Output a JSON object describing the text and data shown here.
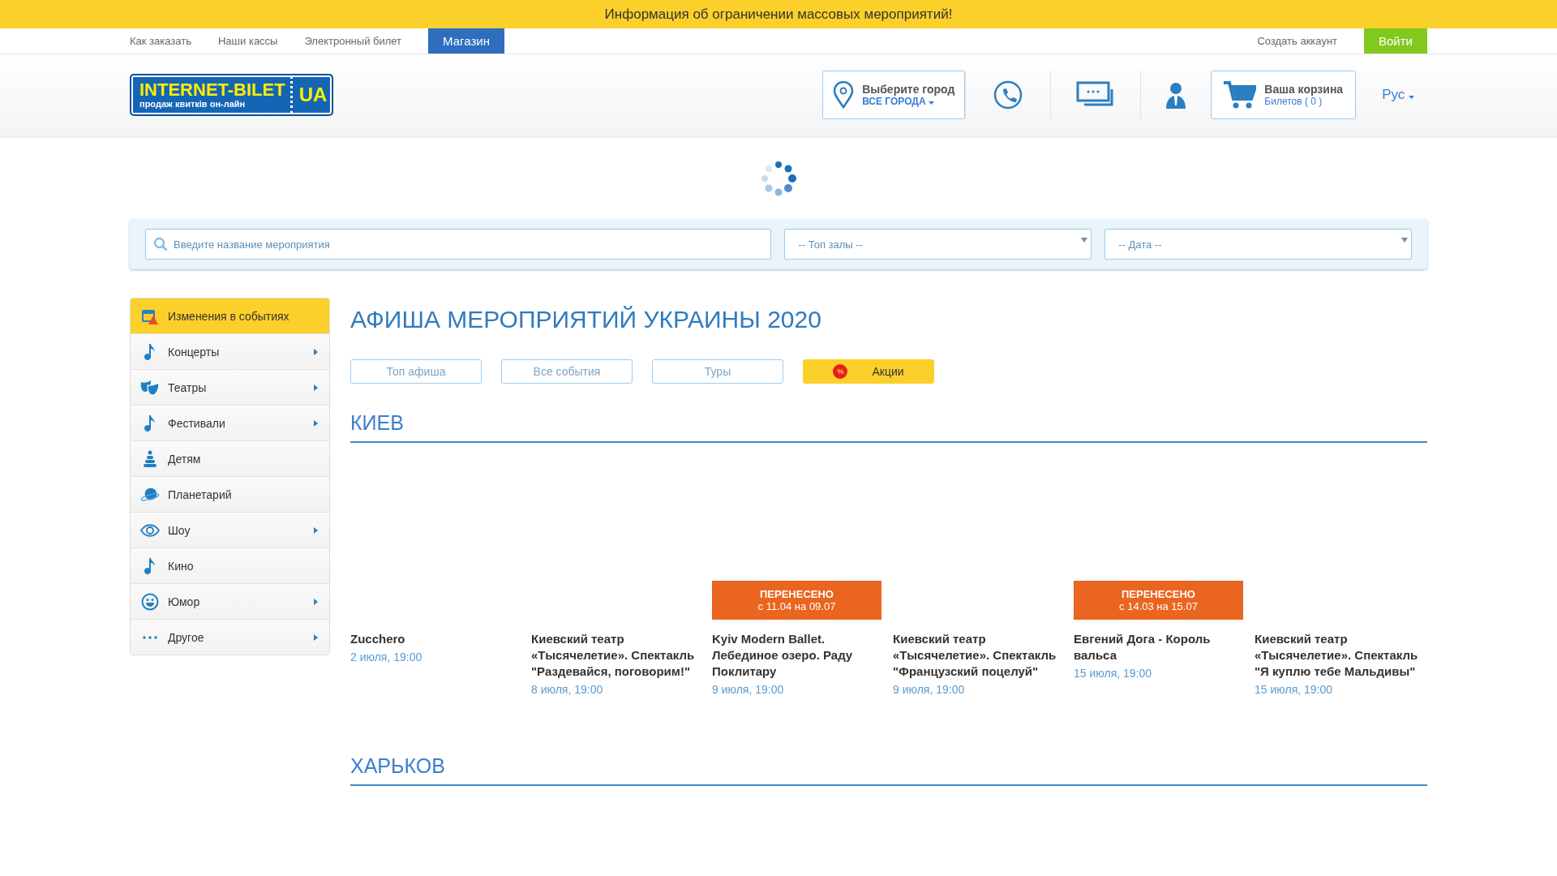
{
  "announcement": "Информация об ограничении массовых мероприятий!",
  "nav": {
    "links": [
      {
        "label": "Как заказать",
        "highlighted": false
      },
      {
        "label": "Наши кассы",
        "highlighted": false
      },
      {
        "label": "Электронный билет",
        "highlighted": false
      },
      {
        "label": "Магазин",
        "highlighted": true
      }
    ],
    "create_account": "Создать аккаунт",
    "login": "Войти"
  },
  "header": {
    "logo": {
      "title": "INTERNET-BILET",
      "suffix": "UA",
      "tagline": "продаж квитків он-лайн"
    },
    "city": {
      "label": "Выберите город",
      "value": "ВСЕ ГОРОДА"
    },
    "cart": {
      "label": "Ваша корзина",
      "count": "Билетов ( 0 )"
    },
    "language": "Рус"
  },
  "search": {
    "placeholder": "Введите название мероприятия",
    "venue": "-- Топ залы --",
    "date": "-- Дата --"
  },
  "sidebar": {
    "items": [
      {
        "label": "Изменения в событиях",
        "selected": true,
        "submenu": false
      },
      {
        "label": "Концерты",
        "selected": false,
        "submenu": true
      },
      {
        "label": "Театры",
        "selected": false,
        "submenu": true
      },
      {
        "label": "Фестивали",
        "selected": false,
        "submenu": true
      },
      {
        "label": "Детям",
        "selected": false,
        "submenu": false
      },
      {
        "label": "Планетарий",
        "selected": false,
        "submenu": false
      },
      {
        "label": "Шоу",
        "selected": false,
        "submenu": true
      },
      {
        "label": "Кино",
        "selected": false,
        "submenu": false
      },
      {
        "label": "Юмор",
        "selected": false,
        "submenu": true
      },
      {
        "label": "Другое",
        "selected": false,
        "submenu": true
      }
    ]
  },
  "main": {
    "title": "АФИША МЕРОПРИЯТИЙ УКРАИНЫ 2020",
    "filters": [
      {
        "label": "Топ афиша",
        "kind": "plain"
      },
      {
        "label": "Все события",
        "kind": "plain"
      },
      {
        "label": "Туры",
        "kind": "plain"
      },
      {
        "label": "Акции",
        "kind": "promo",
        "icon_text": "%"
      }
    ],
    "sections": [
      {
        "city": "КИЕВ",
        "events": [
          {
            "title": "Zucchero",
            "date": "2 июля, 19:00"
          },
          {
            "title": "Киевский театр «Тысячелетие». Спектакль \"Раздевайся, поговорим!\"",
            "date": "8 июля, 19:00"
          },
          {
            "title": "Kyiv Modern Ballet. Лебединое озеро. Раду Поклитару",
            "date": "9 июля, 19:00",
            "badge": {
              "title": "ПЕРЕНЕСЕНО",
              "note": "с 11.04 на 09.07"
            }
          },
          {
            "title": "Киевский театр «Тысячелетие». Спектакль \"Французский поцелуй\"",
            "date": "9 июля, 19:00"
          },
          {
            "title": "Евгений Дога - Король вальса",
            "date": "15 июля, 19:00",
            "badge": {
              "title": "ПЕРЕНЕСЕНО",
              "note": "с 14.03 на 15.07"
            }
          },
          {
            "title": "Киевский театр «Тысячелетие». Спектакль \"Я куплю тебе Мальдивы\"",
            "date": "15 июля, 19:00"
          }
        ]
      },
      {
        "city": "ХАРЬКОВ"
      }
    ]
  }
}
